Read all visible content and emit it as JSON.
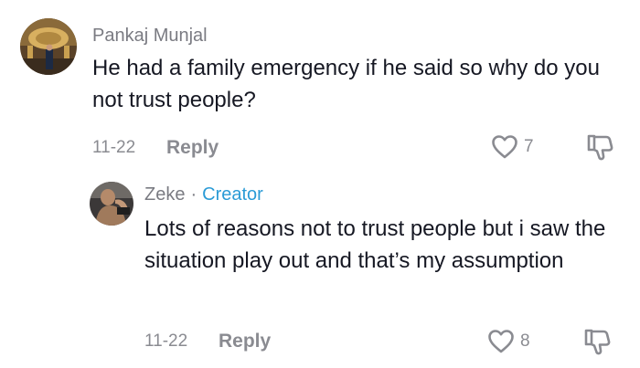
{
  "comments": [
    {
      "username": "Pankaj Munjal",
      "text": "He had a family emergency if he said so why do you not trust people?",
      "date": "11-22",
      "reply_label": "Reply",
      "likes": "7",
      "avatar_icon": "user-avatar-photo"
    }
  ],
  "reply": {
    "username": "Zeke",
    "separator": "·",
    "badge": "Creator",
    "text": "Lots of reasons not to trust people but i saw the situation play out and that’s my assumption",
    "date": "11-22",
    "reply_label": "Reply",
    "likes": "8",
    "avatar_icon": "user-avatar-photo"
  },
  "icons": {
    "like": "heart-outline-icon",
    "dislike": "thumbs-down-outline-icon"
  },
  "colors": {
    "text": "#161823",
    "muted": "#8a8b91",
    "creator": "#2b9bd6"
  }
}
